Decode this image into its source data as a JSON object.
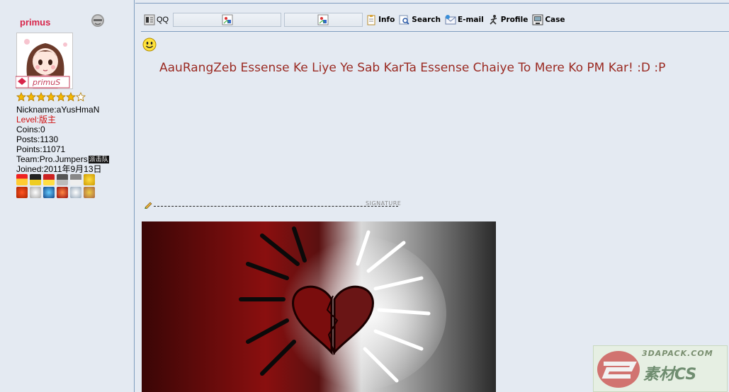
{
  "user": {
    "username": "primus",
    "avatar_tag": "primuS",
    "stars_total": 7,
    "stars_filled": 6,
    "nickname_label": "Nickname:",
    "nickname": "aYusHmaN",
    "level_label": "Level:",
    "level": "版主",
    "coins_label": "Coins:",
    "coins": "0",
    "posts_label": "Posts:",
    "posts": "1130",
    "points_label": "Points:",
    "points": "11071",
    "team_label": "Team:",
    "team": "Pro.Jumpers",
    "team_badge": "派击队",
    "joined_label": "Joined:",
    "joined": "2011年9月13日"
  },
  "toolbar": {
    "qq_label": "QQ",
    "info_label": "Info",
    "search_label": "Search",
    "email_label": "E-mail",
    "profile_label": "Profile",
    "case_label": "Case"
  },
  "post": {
    "message": "AauRangZeb Essense Ke Liye Ye Sab KarTa Essense Chaiye To Mere Ko PM Kar! :D :P",
    "signature_label": "SIGNATURE"
  },
  "watermark": {
    "url": "3DAPACK.COM",
    "name": "素材CS"
  },
  "colors": {
    "username": "#d8254a",
    "message": "#9a2a22",
    "level": "#d01010",
    "background": "#e4eaf2",
    "border": "#7f9dbf"
  }
}
